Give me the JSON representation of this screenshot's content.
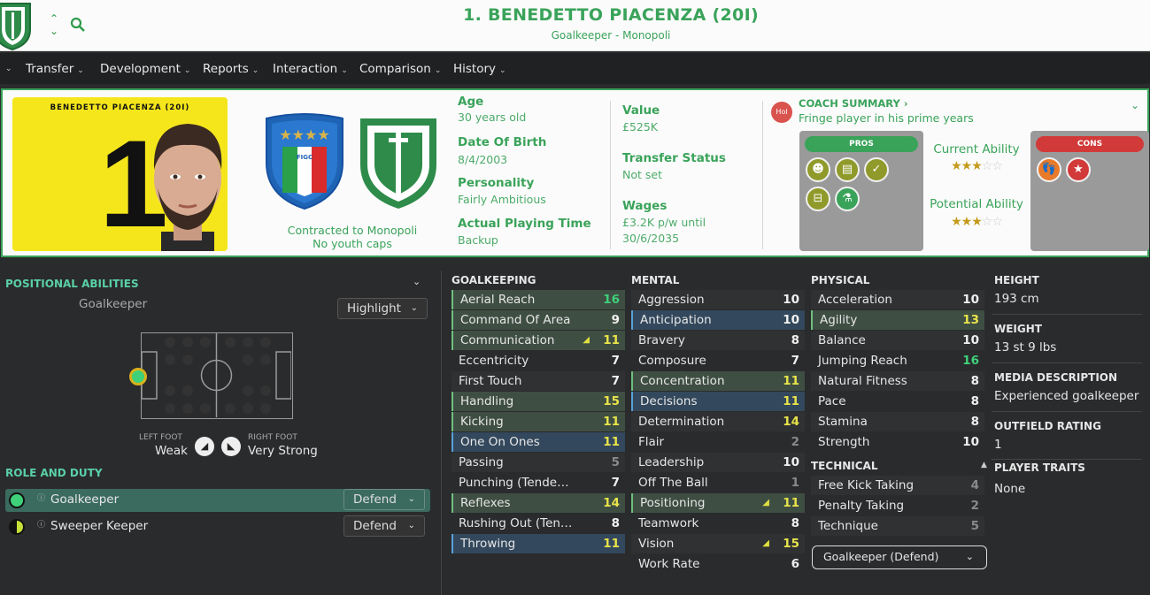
{
  "header": {
    "title": "1. BENEDETTO PIACENZA (20I)",
    "subtitle": "Goalkeeper - Monopoli"
  },
  "nav": [
    "Transfer",
    "Development",
    "Reports",
    "Interaction",
    "Comparison",
    "History"
  ],
  "card": {
    "kit_name": "BENEDETTO PIACENZA (20I)",
    "kit_number": "1",
    "contract_line1": "Contracted to Monopoli",
    "contract_line2": "No youth caps"
  },
  "details": {
    "age_label": "Age",
    "age": "30 years old",
    "dob_label": "Date Of Birth",
    "dob": "8/4/2003",
    "personality_label": "Personality",
    "personality": "Fairly Ambitious",
    "apt_label": "Actual Playing Time",
    "apt": "Backup",
    "value_label": "Value",
    "value": "£525K",
    "ts_label": "Transfer Status",
    "ts": "Not set",
    "wages_label": "Wages",
    "wages1": "£3.2K p/w until",
    "wages2": "30/6/2035"
  },
  "coach": {
    "icon_text": "Hol",
    "title": "COACH SUMMARY ›",
    "summary": "Fringe player in his prime years",
    "pros": "PROS",
    "cons": "CONS",
    "current_label": "Current Ability",
    "potential_label": "Potential Ability",
    "current_stars": 3,
    "potential_stars": 3
  },
  "positional": {
    "title": "POSITIONAL ABILITIES",
    "position": "Goalkeeper",
    "highlight": "Highlight",
    "left_foot_label": "LEFT FOOT",
    "left_foot": "Weak",
    "right_foot_label": "RIGHT FOOT",
    "right_foot": "Very Strong"
  },
  "roles": {
    "title": "ROLE AND DUTY",
    "items": [
      {
        "name": "Goalkeeper",
        "duty": "Defend"
      },
      {
        "name": "Sweeper Keeper",
        "duty": "Defend"
      }
    ]
  },
  "goalkeeping": {
    "title": "GOALKEEPING",
    "rows": [
      {
        "n": "Aerial Reach",
        "v": "16"
      },
      {
        "n": "Command Of Area",
        "v": "9"
      },
      {
        "n": "Communication",
        "v": "11"
      },
      {
        "n": "Eccentricity",
        "v": "7"
      },
      {
        "n": "First Touch",
        "v": "7"
      },
      {
        "n": "Handling",
        "v": "15"
      },
      {
        "n": "Kicking",
        "v": "11"
      },
      {
        "n": "One On Ones",
        "v": "11"
      },
      {
        "n": "Passing",
        "v": "5"
      },
      {
        "n": "Punching (Tende…",
        "v": "7"
      },
      {
        "n": "Reflexes",
        "v": "14"
      },
      {
        "n": "Rushing Out (Ten…",
        "v": "8"
      },
      {
        "n": "Throwing",
        "v": "11"
      }
    ]
  },
  "mental": {
    "title": "MENTAL",
    "rows": [
      {
        "n": "Aggression",
        "v": "10"
      },
      {
        "n": "Anticipation",
        "v": "10"
      },
      {
        "n": "Bravery",
        "v": "8"
      },
      {
        "n": "Composure",
        "v": "7"
      },
      {
        "n": "Concentration",
        "v": "11"
      },
      {
        "n": "Decisions",
        "v": "11"
      },
      {
        "n": "Determination",
        "v": "14"
      },
      {
        "n": "Flair",
        "v": "2"
      },
      {
        "n": "Leadership",
        "v": "10"
      },
      {
        "n": "Off The Ball",
        "v": "1"
      },
      {
        "n": "Positioning",
        "v": "11"
      },
      {
        "n": "Teamwork",
        "v": "8"
      },
      {
        "n": "Vision",
        "v": "15"
      },
      {
        "n": "Work Rate",
        "v": "6"
      }
    ]
  },
  "physical": {
    "title": "PHYSICAL",
    "rows": [
      {
        "n": "Acceleration",
        "v": "10"
      },
      {
        "n": "Agility",
        "v": "13"
      },
      {
        "n": "Balance",
        "v": "10"
      },
      {
        "n": "Jumping Reach",
        "v": "16"
      },
      {
        "n": "Natural Fitness",
        "v": "8"
      },
      {
        "n": "Pace",
        "v": "8"
      },
      {
        "n": "Stamina",
        "v": "8"
      },
      {
        "n": "Strength",
        "v": "10"
      }
    ]
  },
  "technical": {
    "title": "TECHNICAL",
    "rows": [
      {
        "n": "Free Kick Taking",
        "v": "4"
      },
      {
        "n": "Penalty Taking",
        "v": "2"
      },
      {
        "n": "Technique",
        "v": "5"
      }
    ],
    "role_select": "Goalkeeper (Defend)"
  },
  "info": {
    "height_label": "HEIGHT",
    "height": "193 cm",
    "weight_label": "WEIGHT",
    "weight": "13 st 9 lbs",
    "media_label": "MEDIA DESCRIPTION",
    "media": "Experienced goalkeeper",
    "outfield_label": "OUTFIELD RATING",
    "outfield": "1",
    "traits_label": "PLAYER TRAITS",
    "traits": "None"
  },
  "colors": {
    "accent": "#3aa35a",
    "high": "#3fd17a",
    "mid": "#e8e44a",
    "low": "#8a8a8a"
  }
}
